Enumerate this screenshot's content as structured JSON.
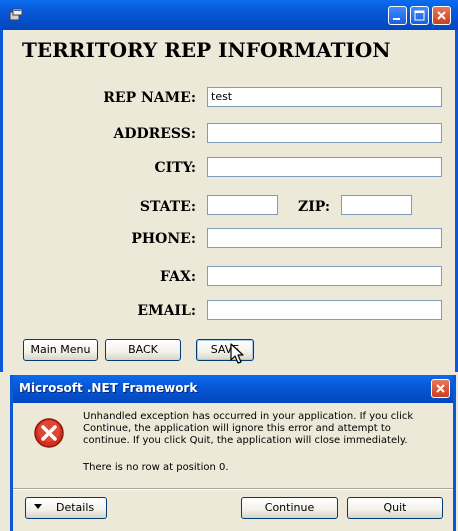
{
  "window": {
    "title": "",
    "form_title": "TERRITORY REP INFORMATION"
  },
  "form": {
    "rep_name": {
      "label": "REP NAME:",
      "value": "test"
    },
    "address": {
      "label": "ADDRESS:",
      "value": ""
    },
    "city": {
      "label": "CITY:",
      "value": ""
    },
    "state": {
      "label": "STATE:",
      "value": ""
    },
    "zip": {
      "label": "ZIP:",
      "value": ""
    },
    "phone": {
      "label": "PHONE:",
      "value": ""
    },
    "fax": {
      "label": "FAX:",
      "value": ""
    },
    "email": {
      "label": "EMAIL:",
      "value": ""
    }
  },
  "buttons": {
    "main_menu": "Main Menu",
    "back": "BACK",
    "save": "SAVE"
  },
  "dialog": {
    "title": "Microsoft .NET Framework",
    "message": "Unhandled exception has occurred in your application. If you click Continue, the application will ignore this error and attempt to continue. If you click Quit, the application will close immediately.",
    "detail": "There is no row at position 0.",
    "details_button": "Details",
    "continue_button": "Continue",
    "quit_button": "Quit"
  },
  "colors": {
    "titlebar": "#0858d6",
    "window_bg": "#ece9d8",
    "close_button": "#c8401c",
    "error_icon": "#d32f1c"
  },
  "icons": [
    "app-icon",
    "minimize-icon",
    "maximize-icon",
    "close-icon",
    "error-icon",
    "dropdown-arrow-icon",
    "mouse-cursor-icon"
  ]
}
